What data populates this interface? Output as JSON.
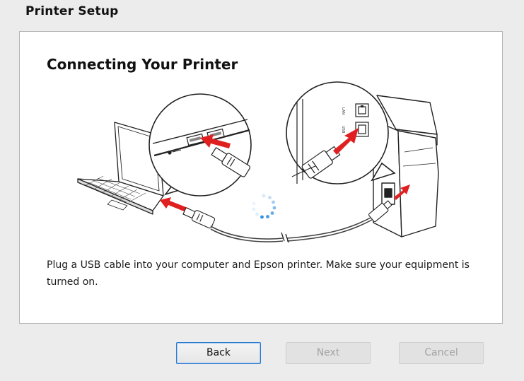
{
  "window": {
    "title": "Printer Setup"
  },
  "panel": {
    "heading": "Connecting Your Printer",
    "instructions": "Plug a USB cable into your computer and Epson printer. Make sure your equipment is turned on.",
    "illustration_labels": {
      "lan_port": "LAN",
      "usb_port": "USB"
    },
    "accent_color": "#e02020",
    "spinner_color": "#2f8fe6"
  },
  "buttons": {
    "back": {
      "label": "Back",
      "enabled": true
    },
    "next": {
      "label": "Next",
      "enabled": false
    },
    "cancel": {
      "label": "Cancel",
      "enabled": false
    }
  }
}
